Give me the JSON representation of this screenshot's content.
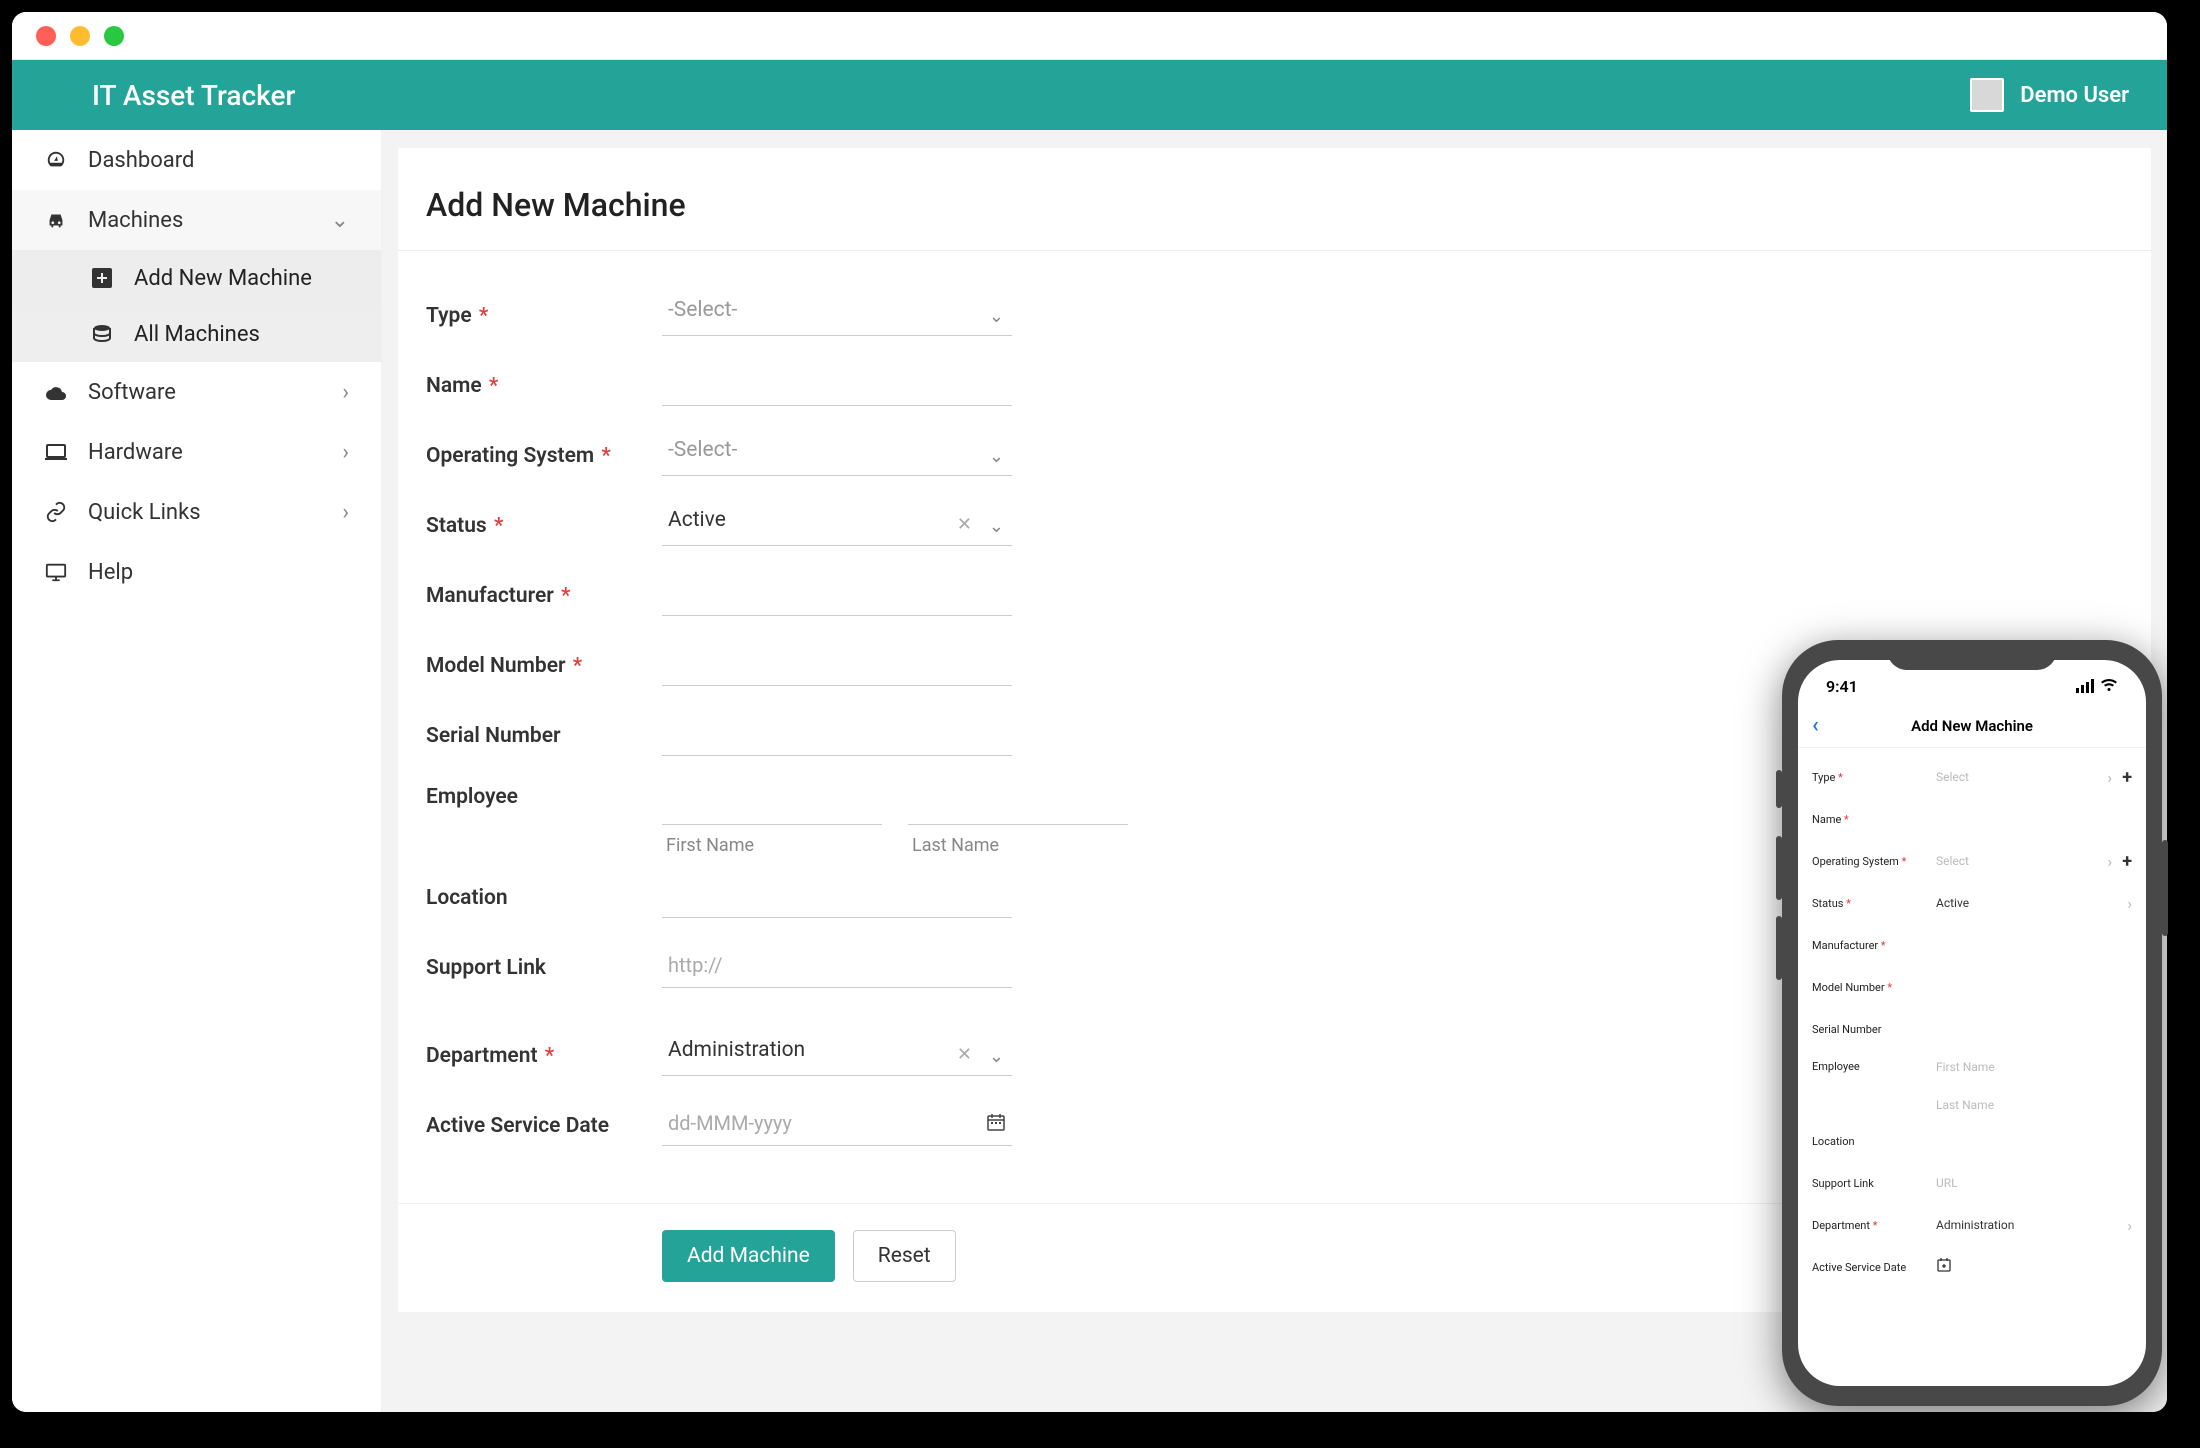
{
  "app_title": "IT Asset Tracker",
  "user_name": "Demo User",
  "sidebar": {
    "dashboard": "Dashboard",
    "machines": "Machines",
    "add_new_machine": "Add New Machine",
    "all_machines": "All Machines",
    "software": "Software",
    "hardware": "Hardware",
    "quick_links": "Quick Links",
    "help": "Help"
  },
  "form": {
    "title": "Add New Machine",
    "labels": {
      "type": "Type",
      "name": "Name",
      "os": "Operating System",
      "status": "Status",
      "manufacturer": "Manufacturer",
      "model_number": "Model Number",
      "serial_number": "Serial Number",
      "employee": "Employee",
      "first_name": "First Name",
      "last_name": "Last Name",
      "location": "Location",
      "support_link": "Support Link",
      "department": "Department",
      "active_service_date": "Active Service Date"
    },
    "placeholders": {
      "select": "-Select-",
      "http": "http://",
      "date": "dd-MMM-yyyy"
    },
    "values": {
      "status": "Active",
      "department": "Administration"
    },
    "buttons": {
      "add": "Add Machine",
      "reset": "Reset"
    }
  },
  "phone": {
    "time": "9:41",
    "title": "Add New Machine",
    "labels": {
      "type": "Type",
      "name": "Name",
      "os": "Operating System",
      "status": "Status",
      "manufacturer": "Manufacturer",
      "model_number": "Model Number",
      "serial_number": "Serial Number",
      "employee": "Employee",
      "first_name": "First Name",
      "last_name": "Last Name",
      "location": "Location",
      "support_link": "Support Link",
      "url": "URL",
      "department": "Department",
      "active_service_date": "Active Service Date",
      "select": "Select"
    },
    "values": {
      "status": "Active",
      "department": "Administration"
    }
  }
}
